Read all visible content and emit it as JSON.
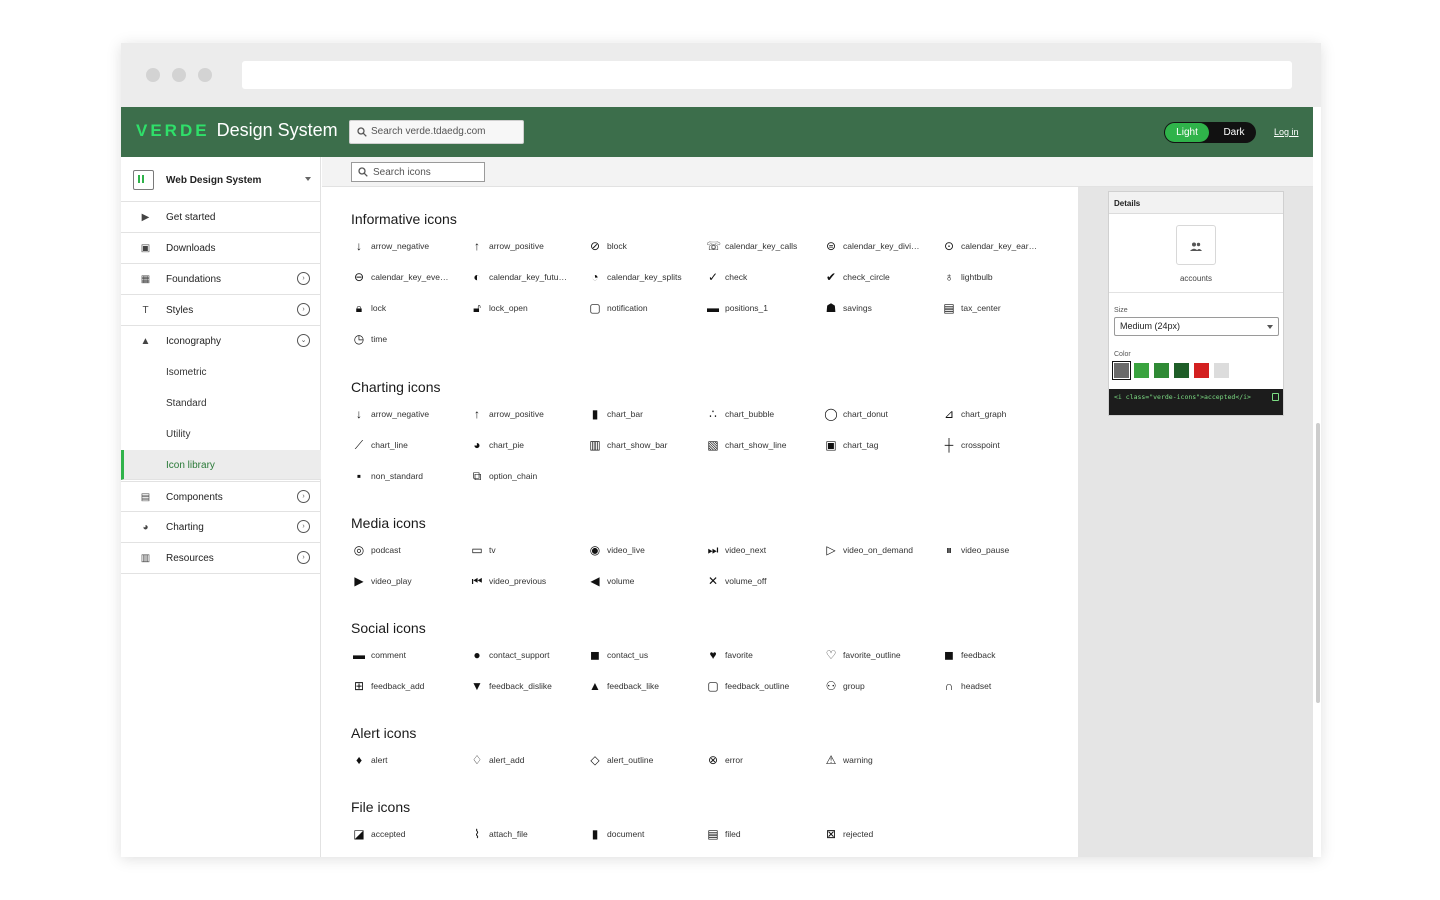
{
  "header": {
    "logo": "VERDE",
    "title": "Design System",
    "search_placeholder": "Search verde.tdaedg.com",
    "theme_light": "Light",
    "theme_dark": "Dark",
    "login": "Log in"
  },
  "sidebar": {
    "selector": "Web Design System",
    "items": [
      {
        "label": "Get started"
      },
      {
        "label": "Downloads"
      },
      {
        "label": "Foundations"
      },
      {
        "label": "Styles"
      },
      {
        "label": "Iconography"
      },
      {
        "label": "Components"
      },
      {
        "label": "Charting"
      },
      {
        "label": "Resources"
      }
    ],
    "subitems": [
      {
        "label": "Isometric"
      },
      {
        "label": "Standard"
      },
      {
        "label": "Utility"
      },
      {
        "label": "Icon library"
      }
    ]
  },
  "main": {
    "icon_search_placeholder": "Search icons",
    "sections": [
      {
        "title": "Informative icons",
        "icons": [
          "arrow_negative",
          "arrow_positive",
          "block",
          "calendar_key_calls",
          "calendar_key_divi…",
          "calendar_key_ear…",
          "calendar_key_eve…",
          "calendar_key_futu…",
          "calendar_key_splits",
          "check",
          "check_circle",
          "lightbulb",
          "lock",
          "lock_open",
          "notification",
          "positions_1",
          "savings",
          "tax_center",
          "time"
        ]
      },
      {
        "title": "Charting icons",
        "icons": [
          "arrow_negative",
          "arrow_positive",
          "chart_bar",
          "chart_bubble",
          "chart_donut",
          "chart_graph",
          "chart_line",
          "chart_pie",
          "chart_show_bar",
          "chart_show_line",
          "chart_tag",
          "crosspoint",
          "non_standard",
          "option_chain"
        ]
      },
      {
        "title": "Media icons",
        "icons": [
          "podcast",
          "tv",
          "video_live",
          "video_next",
          "video_on_demand",
          "video_pause",
          "video_play",
          "video_previous",
          "volume",
          "volume_off"
        ]
      },
      {
        "title": "Social icons",
        "icons": [
          "comment",
          "contact_support",
          "contact_us",
          "favorite",
          "favorite_outline",
          "feedback",
          "feedback_add",
          "feedback_dislike",
          "feedback_like",
          "feedback_outline",
          "group",
          "headset"
        ]
      },
      {
        "title": "Alert icons",
        "icons": [
          "alert",
          "alert_add",
          "alert_outline",
          "error",
          "warning"
        ]
      },
      {
        "title": "File icons",
        "icons": [
          "accepted",
          "attach_file",
          "document",
          "filed",
          "rejected"
        ]
      }
    ]
  },
  "details": {
    "title": "Details",
    "icon_name": "accounts",
    "size_label": "Size",
    "size_value": "Medium (24px)",
    "color_label": "Color",
    "code": "<i class=\"verde-icons\">accepted</i>",
    "swatches": [
      "#6a6a6a",
      "#3aa33f",
      "#2f8a35",
      "#1f5e28",
      "#d32020",
      "#dcdcdc"
    ]
  }
}
